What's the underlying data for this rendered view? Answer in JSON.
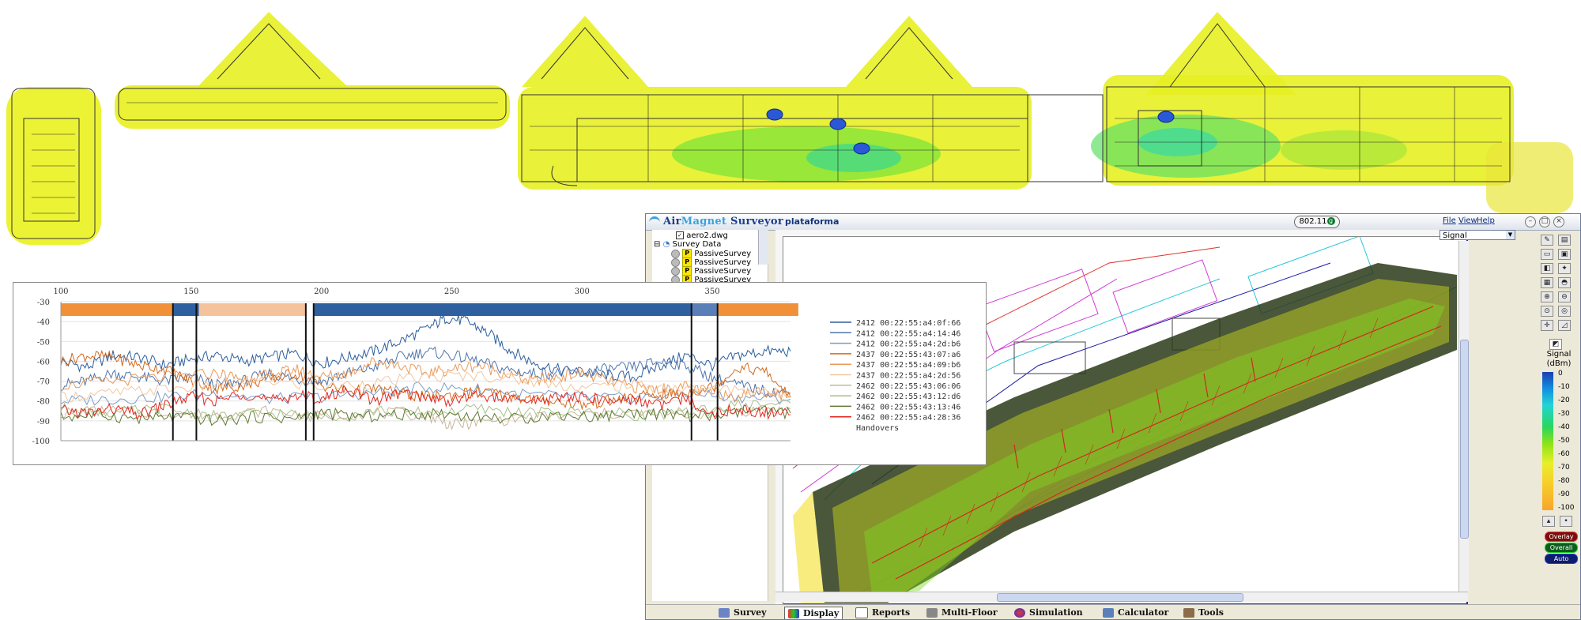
{
  "window": {
    "app_name_part1": "Air",
    "app_name_part2": "Magnet",
    "app_name_part3": " Surveyor",
    "project": "plataforma",
    "standard": "802.11",
    "standard_badge": "g",
    "menu": [
      "File",
      "View",
      "Help"
    ],
    "layer_select": "Signal"
  },
  "tree": {
    "file": "aero2.dwg",
    "survey_data_label": "Survey Data",
    "items": [
      "PassiveSurvey",
      "PassiveSurvey",
      "PassiveSurvey",
      "PassiveSurvey"
    ]
  },
  "legend": {
    "title": "Signal\n(dBm)",
    "ticks": [
      "0",
      "-10",
      "-20",
      "-30",
      "-40",
      "-50",
      "-60",
      "-70",
      "-80",
      "-90",
      "-100"
    ],
    "buttons": [
      "Overlay",
      "Overall",
      "Auto"
    ]
  },
  "tabs": [
    "Survey",
    "Display",
    "Reports",
    "Multi-Floor",
    "Simulation",
    "Calculator",
    "Tools"
  ],
  "active_tab": "Display",
  "chart_data": {
    "type": "line",
    "title": "",
    "xlabel": "",
    "ylabel": "",
    "xlim": [
      100,
      380
    ],
    "ylim": [
      -100,
      -30
    ],
    "x_ticks": [
      100,
      150,
      200,
      250,
      300,
      350
    ],
    "y_ticks": [
      -30,
      -40,
      -50,
      -60,
      -70,
      -80,
      -90,
      -100
    ],
    "legend_position": "right",
    "series": [
      {
        "name": "2412 00:22:55:a4:0f:66",
        "color": "#2e5f9e",
        "points": [
          [
            100,
            -60
          ],
          [
            110,
            -63
          ],
          [
            120,
            -57
          ],
          [
            130,
            -58
          ],
          [
            140,
            -62
          ],
          [
            150,
            -59
          ],
          [
            160,
            -57
          ],
          [
            170,
            -60
          ],
          [
            180,
            -58
          ],
          [
            190,
            -56
          ],
          [
            200,
            -61
          ],
          [
            210,
            -58
          ],
          [
            220,
            -55
          ],
          [
            230,
            -50
          ],
          [
            240,
            -44
          ],
          [
            248,
            -38
          ],
          [
            256,
            -40
          ],
          [
            264,
            -46
          ],
          [
            272,
            -54
          ],
          [
            280,
            -60
          ],
          [
            290,
            -64
          ],
          [
            300,
            -66
          ],
          [
            310,
            -67
          ],
          [
            320,
            -68
          ],
          [
            330,
            -62
          ],
          [
            340,
            -57
          ],
          [
            350,
            -62
          ],
          [
            360,
            -57
          ],
          [
            370,
            -55
          ],
          [
            380,
            -55
          ]
        ]
      },
      {
        "name": "2412 00:22:55:a4:14:46",
        "color": "#4f75ae",
        "points": [
          [
            100,
            -72
          ],
          [
            110,
            -70
          ],
          [
            120,
            -66
          ],
          [
            130,
            -68
          ],
          [
            140,
            -70
          ],
          [
            150,
            -68
          ],
          [
            160,
            -72
          ],
          [
            170,
            -70
          ],
          [
            180,
            -66
          ],
          [
            190,
            -69
          ],
          [
            200,
            -70
          ],
          [
            210,
            -66
          ],
          [
            220,
            -63
          ],
          [
            230,
            -58
          ],
          [
            240,
            -55
          ],
          [
            250,
            -57
          ],
          [
            260,
            -60
          ],
          [
            270,
            -64
          ],
          [
            280,
            -66
          ],
          [
            290,
            -66
          ],
          [
            300,
            -65
          ],
          [
            310,
            -64
          ],
          [
            320,
            -63
          ],
          [
            330,
            -60
          ],
          [
            340,
            -62
          ],
          [
            350,
            -68
          ],
          [
            360,
            -72
          ],
          [
            370,
            -75
          ],
          [
            380,
            -76
          ]
        ]
      },
      {
        "name": "2412 00:22:55:a4:2d:b6",
        "color": "#7a9cc8",
        "points": [
          [
            100,
            -80
          ],
          [
            120,
            -79
          ],
          [
            140,
            -78
          ],
          [
            160,
            -76
          ],
          [
            180,
            -79
          ],
          [
            200,
            -78
          ],
          [
            220,
            -76
          ],
          [
            240,
            -73
          ],
          [
            260,
            -74
          ],
          [
            280,
            -77
          ],
          [
            300,
            -78
          ],
          [
            320,
            -79
          ],
          [
            340,
            -76
          ],
          [
            360,
            -78
          ],
          [
            380,
            -79
          ]
        ]
      },
      {
        "name": "2437 00:22:55:43:07:a6",
        "color": "#d46a1f",
        "points": [
          [
            100,
            -60
          ],
          [
            110,
            -57
          ],
          [
            120,
            -58
          ],
          [
            130,
            -62
          ],
          [
            140,
            -64
          ],
          [
            150,
            -70
          ],
          [
            160,
            -74
          ],
          [
            170,
            -72
          ],
          [
            180,
            -69
          ],
          [
            190,
            -66
          ],
          [
            200,
            -72
          ],
          [
            210,
            -75
          ],
          [
            220,
            -74
          ],
          [
            230,
            -76
          ],
          [
            240,
            -78
          ],
          [
            250,
            -77
          ],
          [
            260,
            -75
          ],
          [
            270,
            -77
          ],
          [
            280,
            -79
          ],
          [
            290,
            -80
          ],
          [
            300,
            -82
          ],
          [
            310,
            -80
          ],
          [
            320,
            -78
          ],
          [
            330,
            -77
          ],
          [
            340,
            -76
          ],
          [
            350,
            -73
          ],
          [
            360,
            -63
          ],
          [
            370,
            -65
          ],
          [
            380,
            -78
          ]
        ]
      },
      {
        "name": "2437 00:22:55:a4:09:b6",
        "color": "#e89a5b",
        "points": [
          [
            100,
            -72
          ],
          [
            120,
            -70
          ],
          [
            140,
            -68
          ],
          [
            160,
            -66
          ],
          [
            170,
            -69
          ],
          [
            180,
            -67
          ],
          [
            190,
            -64
          ],
          [
            200,
            -68
          ],
          [
            210,
            -66
          ],
          [
            220,
            -60
          ],
          [
            230,
            -62
          ],
          [
            240,
            -66
          ],
          [
            250,
            -64
          ],
          [
            260,
            -62
          ],
          [
            270,
            -66
          ],
          [
            280,
            -70
          ],
          [
            290,
            -68
          ],
          [
            300,
            -66
          ],
          [
            310,
            -70
          ],
          [
            320,
            -73
          ],
          [
            330,
            -74
          ],
          [
            340,
            -73
          ],
          [
            350,
            -76
          ],
          [
            360,
            -77
          ],
          [
            370,
            -75
          ],
          [
            380,
            -78
          ]
        ]
      },
      {
        "name": "2437 00:22:55:a4:2d:56",
        "color": "#f3c7a0",
        "points": [
          [
            100,
            -78
          ],
          [
            120,
            -76
          ],
          [
            140,
            -74
          ],
          [
            160,
            -72
          ],
          [
            180,
            -70
          ],
          [
            200,
            -73
          ],
          [
            220,
            -71
          ],
          [
            240,
            -68
          ],
          [
            260,
            -67
          ],
          [
            280,
            -70
          ],
          [
            300,
            -73
          ],
          [
            320,
            -72
          ],
          [
            340,
            -74
          ],
          [
            360,
            -74
          ],
          [
            380,
            -77
          ]
        ]
      },
      {
        "name": "2462 00:22:55:43:06:06",
        "color": "#c9b699",
        "points": [
          [
            100,
            -86
          ],
          [
            120,
            -85
          ],
          [
            140,
            -86
          ],
          [
            160,
            -87
          ],
          [
            180,
            -85
          ],
          [
            200,
            -88
          ],
          [
            220,
            -86
          ],
          [
            240,
            -87
          ],
          [
            250,
            -92
          ],
          [
            260,
            -91
          ],
          [
            280,
            -88
          ],
          [
            300,
            -87
          ],
          [
            320,
            -86
          ],
          [
            340,
            -87
          ],
          [
            360,
            -85
          ],
          [
            380,
            -84
          ]
        ]
      },
      {
        "name": "2462 00:22:55:43:12:d6",
        "color": "#a9c08a",
        "points": [
          [
            100,
            -84
          ],
          [
            120,
            -86
          ],
          [
            140,
            -84
          ],
          [
            160,
            -88
          ],
          [
            180,
            -86
          ],
          [
            200,
            -88
          ],
          [
            220,
            -85
          ],
          [
            240,
            -86
          ],
          [
            260,
            -84
          ],
          [
            280,
            -86
          ],
          [
            300,
            -85
          ],
          [
            320,
            -87
          ],
          [
            340,
            -86
          ],
          [
            360,
            -82
          ],
          [
            380,
            -81
          ]
        ]
      },
      {
        "name": "2462 00:22:55:43:13:46",
        "color": "#5f7a34",
        "points": [
          [
            100,
            -88
          ],
          [
            115,
            -87
          ],
          [
            130,
            -89
          ],
          [
            145,
            -88
          ],
          [
            160,
            -90
          ],
          [
            175,
            -88
          ],
          [
            190,
            -89
          ],
          [
            200,
            -86
          ],
          [
            215,
            -88
          ],
          [
            230,
            -87
          ],
          [
            245,
            -86
          ],
          [
            260,
            -88
          ],
          [
            275,
            -89
          ],
          [
            290,
            -87
          ],
          [
            305,
            -88
          ],
          [
            320,
            -86
          ],
          [
            335,
            -87
          ],
          [
            350,
            -88
          ],
          [
            365,
            -85
          ],
          [
            380,
            -86
          ]
        ]
      },
      {
        "name": "2462 00:22:55:a4:28:36",
        "color": "#e2281f",
        "points": [
          [
            100,
            -85
          ],
          [
            110,
            -86
          ],
          [
            120,
            -84
          ],
          [
            130,
            -87
          ],
          [
            140,
            -82
          ],
          [
            150,
            -78
          ],
          [
            160,
            -80
          ],
          [
            170,
            -76
          ],
          [
            180,
            -80
          ],
          [
            190,
            -77
          ],
          [
            200,
            -79
          ],
          [
            210,
            -74
          ],
          [
            220,
            -80
          ],
          [
            230,
            -76
          ],
          [
            240,
            -78
          ],
          [
            250,
            -80
          ],
          [
            260,
            -77
          ],
          [
            270,
            -79
          ],
          [
            280,
            -80
          ],
          [
            290,
            -78
          ],
          [
            300,
            -78
          ],
          [
            310,
            -80
          ],
          [
            320,
            -79
          ],
          [
            330,
            -82
          ],
          [
            340,
            -79
          ],
          [
            350,
            -86
          ],
          [
            360,
            -84
          ],
          [
            370,
            -86
          ],
          [
            380,
            -87
          ]
        ]
      }
    ],
    "handovers_label": "Handovers",
    "handover_lines": [
      143,
      152,
      194,
      197,
      342,
      352
    ],
    "handover_bands": [
      {
        "from": 100,
        "to": 143,
        "color": "#f0913a"
      },
      {
        "from": 143,
        "to": 153,
        "color": "#2e5f9e"
      },
      {
        "from": 153,
        "to": 194,
        "color": "#f4c29b"
      },
      {
        "from": 197,
        "to": 342,
        "color": "#2e5f9e"
      },
      {
        "from": 342,
        "to": 352,
        "color": "#5a7fb8"
      },
      {
        "from": 352,
        "to": 383,
        "color": "#f0913a"
      }
    ]
  }
}
